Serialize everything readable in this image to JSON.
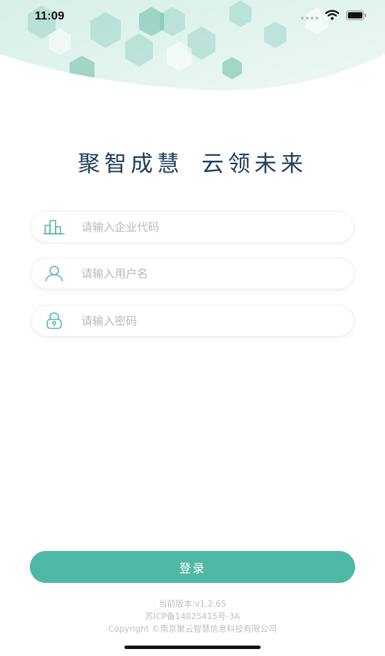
{
  "status_bar": {
    "time": "11:09",
    "icons": [
      "signal-dots-icon",
      "wifi-icon",
      "battery-icon"
    ]
  },
  "slogan": {
    "part1": "聚智成慧",
    "part2": "云领未来"
  },
  "form": {
    "company_code": {
      "placeholder": "请输入企业代码",
      "icon": "building-icon"
    },
    "username": {
      "placeholder": "请输入用户名",
      "icon": "user-icon"
    },
    "password": {
      "placeholder": "请输入密码",
      "icon": "lock-icon"
    }
  },
  "login_button": "登录",
  "footer": {
    "version": "当前版本:v1.2.65",
    "icp": "苏ICP备14025415号-3A",
    "copyright": "Copyright ©南京聚云智慧信息科技有限公司"
  },
  "colors": {
    "accent": "#4fb8a4",
    "title": "#21405a",
    "placeholder": "#b7b9bb"
  }
}
